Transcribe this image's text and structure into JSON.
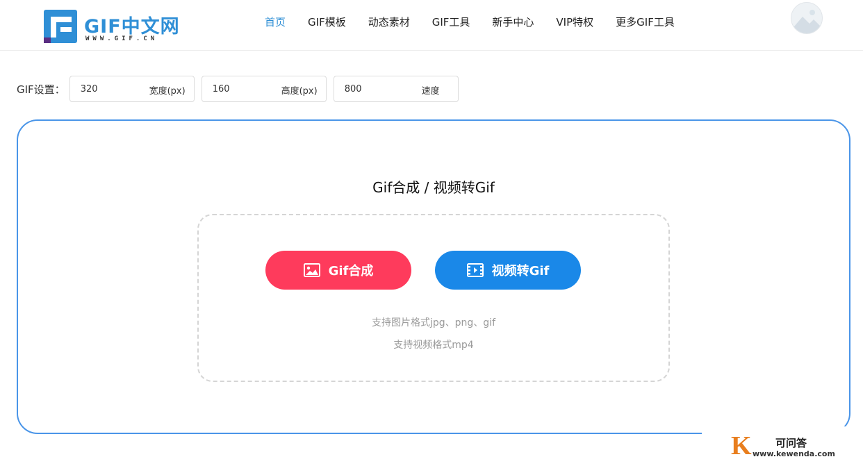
{
  "header": {
    "logo_text": "GIF中文网",
    "logo_sub": "WWW.GIF.CN",
    "nav": [
      {
        "label": "首页",
        "active": true
      },
      {
        "label": "GIF模板",
        "active": false
      },
      {
        "label": "动态素材",
        "active": false
      },
      {
        "label": "GIF工具",
        "active": false
      },
      {
        "label": "新手中心",
        "active": false
      },
      {
        "label": "VIP特权",
        "active": false
      },
      {
        "label": "更多GIF工具",
        "active": false
      }
    ],
    "avatar_icon": "user-avatar-icon"
  },
  "settings": {
    "label": "GIF设置：",
    "width": {
      "value": "320",
      "unit": "宽度(px)"
    },
    "height": {
      "value": "160",
      "unit": "高度(px)"
    },
    "speed": {
      "value": "800",
      "unit": "速度"
    }
  },
  "panel": {
    "title": "Gif合成 / 视频转Gif",
    "gif_button": "Gif合成",
    "video_button": "视频转Gif",
    "hint_image": "支持图片格式jpg、png、gif",
    "hint_video": "支持视频格式mp4"
  },
  "watermark": {
    "letter": "K",
    "title": "可问答",
    "url": "www.kewenda.com"
  },
  "colors": {
    "accent": "#2f8fd6",
    "panel_border": "#4a95e8",
    "gif_button": "#fe3b5c",
    "video_button": "#1a88e8"
  }
}
